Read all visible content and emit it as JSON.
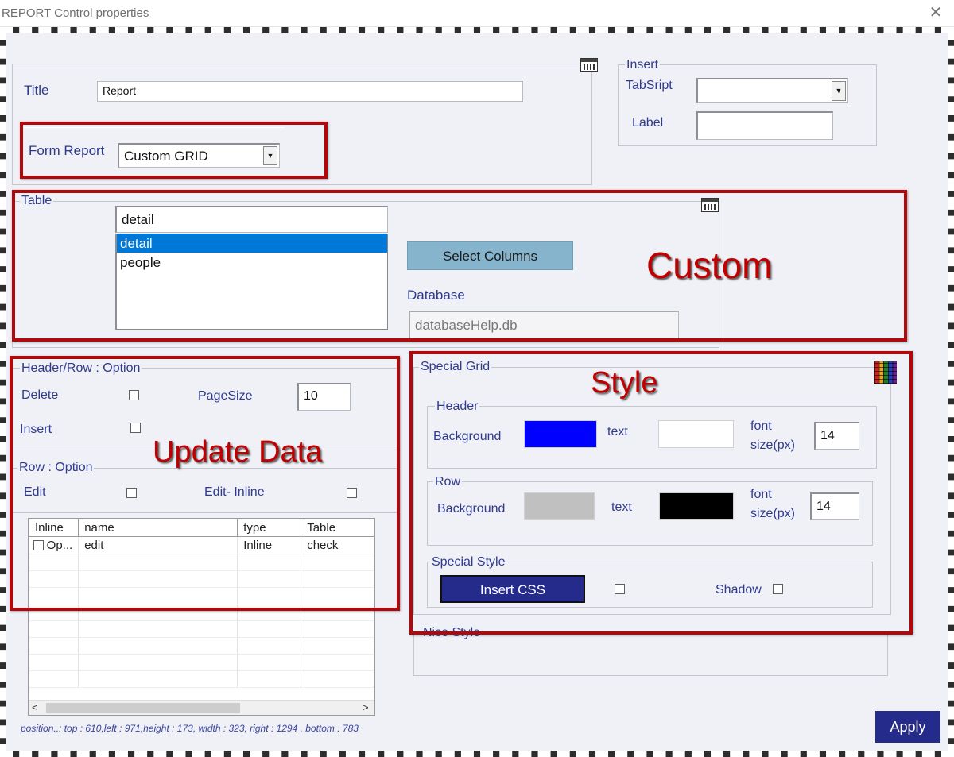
{
  "window": {
    "title": "REPORT Control properties",
    "close_glyph": "✕"
  },
  "general": {
    "title_label": "Title",
    "title_value": "Report",
    "form_report_label": "Form Report",
    "form_report_value": "Custom GRID"
  },
  "insert": {
    "legend": "Insert",
    "tabscript_label": "TabSript",
    "tabscript_value": "",
    "label_label": "Label",
    "label_value": ""
  },
  "table": {
    "legend": "Table",
    "search_value": "detail",
    "items": [
      "detail",
      "people"
    ],
    "selected_index": 0,
    "select_columns_label": "Select Columns",
    "database_label": "Database",
    "database_value": "databaseHelp.db"
  },
  "header_row_option": {
    "legend": "Header/Row : Option",
    "delete_label": "Delete",
    "insert_label": "Insert",
    "pagesize_label": "PageSize",
    "pagesize_value": "10"
  },
  "row_option": {
    "legend": "Row : Option",
    "edit_label": "Edit",
    "edit_inline_label": "Edit- Inline"
  },
  "grid": {
    "columns": [
      "Inline",
      "name",
      "type",
      "Table"
    ],
    "rows": [
      {
        "inline": "Op...",
        "name": "edit",
        "type": "Inline",
        "table": "check"
      }
    ]
  },
  "special_grid": {
    "legend": "Special Grid",
    "header": {
      "legend": "Header",
      "background_label": "Background",
      "background_color": "#0000ff",
      "text_label": "text",
      "text_color": "#ffffff",
      "font_label_1": "font",
      "font_label_2": "size(px)",
      "font_value": "14"
    },
    "row": {
      "legend": "Row",
      "background_label": "Background",
      "background_color": "#c0c0c0",
      "text_label": "text",
      "text_color": "#000000",
      "font_label_1": "font",
      "font_label_2": "size(px)",
      "font_value": "14"
    },
    "special_style": {
      "legend": "Special Style",
      "insert_css_label": "Insert  CSS",
      "shadow_label": "Shadow"
    }
  },
  "nice_style": {
    "legend": "Nice Style"
  },
  "annotations": {
    "custom": "Custom",
    "style": "Style",
    "update_data": "Update Data"
  },
  "status_text": "position..:   top : 610,left : 971,height : 173, width  : 323, right : 1294 , bottom : 783",
  "apply_label": "Apply",
  "colors": {
    "accent": "#2f3a8f",
    "annotation_red": "#c00000",
    "selected_item": "#0078d7",
    "select_columns_bg": "#86b4cc",
    "insert_css_bg": "#252b8a",
    "apply_bg": "#252b8a"
  },
  "icons": [
    "calendar-icon",
    "color-grid-icon",
    "close-icon",
    "dropdown-arrow-icon"
  ]
}
